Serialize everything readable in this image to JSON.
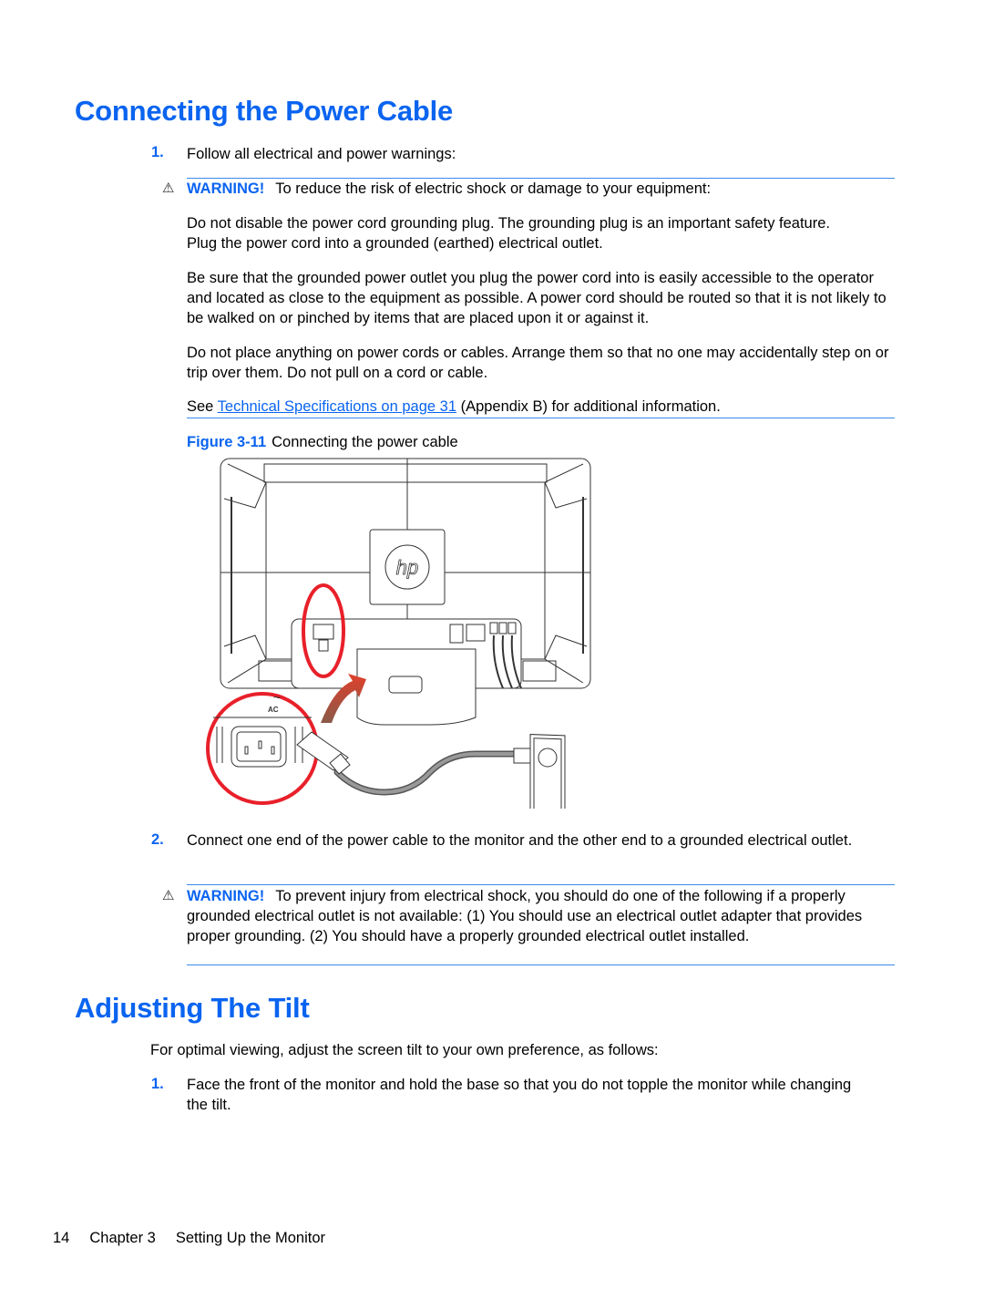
{
  "section1": {
    "title": "Connecting the Power Cable",
    "step1": {
      "number": "1.",
      "text": "Follow all electrical and power warnings:"
    },
    "warning1": {
      "icon": "warning-triangle-icon",
      "label": "WARNING!",
      "intro": "To reduce the risk of electric shock or damage to your equipment:",
      "paragraphs": [
        "Do not disable the power cord grounding plug. The grounding plug is an important safety feature. Plug the power cord into a grounded (earthed) electrical outlet.",
        "Be sure that the grounded power outlet you plug the power cord into is easily accessible to the operator and located as close to the equipment as possible. A power cord should be routed so that it is not likely to be walked on or pinched by items that are placed upon it or against it.",
        "Do not place anything on power cords or cables. Arrange them so that no one may accidentally step on or trip over them. Do not pull on a cord or cable."
      ],
      "see_prefix": "See ",
      "see_link": "Technical Specifications on page 31",
      "see_suffix": " (Appendix B) for additional information."
    },
    "figure": {
      "label": "Figure 3-11",
      "caption": "Connecting the power cable",
      "logo_text": "hp",
      "ac_label": "AC",
      "ac_symbol": "~"
    },
    "step2": {
      "number": "2.",
      "text": "Connect one end of the power cable to the monitor and the other end to a grounded electrical outlet."
    },
    "warning2": {
      "icon": "warning-triangle-icon",
      "label": "WARNING!",
      "text": "To prevent injury from electrical shock, you should do one of the following if a properly grounded electrical outlet is not available: (1) You should use an electrical outlet adapter that provides proper grounding. (2) You should have a properly grounded electrical outlet installed."
    }
  },
  "section2": {
    "title": "Adjusting The Tilt",
    "intro": "For optimal viewing, adjust the screen tilt to your own preference, as follows:",
    "step1": {
      "number": "1.",
      "text": "Face the front of the monitor and hold the base so that you do not topple the monitor while changing the tilt."
    }
  },
  "footer": {
    "page_number": "14",
    "chapter": "Chapter 3",
    "chapter_title": "Setting Up the Monitor"
  },
  "colors": {
    "accent": "#0a64f0",
    "highlight_red": "#e8202a"
  }
}
